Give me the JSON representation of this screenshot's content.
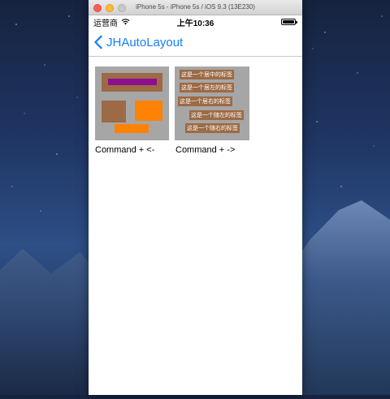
{
  "window": {
    "title": "iPhone 5s - iPhone 5s / iOS 9.3 (13E230)"
  },
  "status_bar": {
    "carrier": "运营商",
    "time": "上午10:36"
  },
  "nav": {
    "title": "JHAutoLayout"
  },
  "demos": [
    {
      "caption": "Command + <-"
    },
    {
      "caption": "Command + ->"
    }
  ],
  "labels_demo": {
    "labels": [
      "这是一个居中的标签",
      "这是一个居左的标签",
      "这是一个居右的标签",
      "这是一个随左的标签",
      "这是一个随右的标签"
    ]
  },
  "icons": [
    "back-chevron-icon",
    "wifi-icon",
    "battery-icon"
  ],
  "colors": {
    "ios_blue": "#157efb",
    "thumb_gray": "#a6a6a6",
    "brown": "#9c6a45",
    "purple": "#8e0f8e",
    "orange": "#fd8206"
  }
}
